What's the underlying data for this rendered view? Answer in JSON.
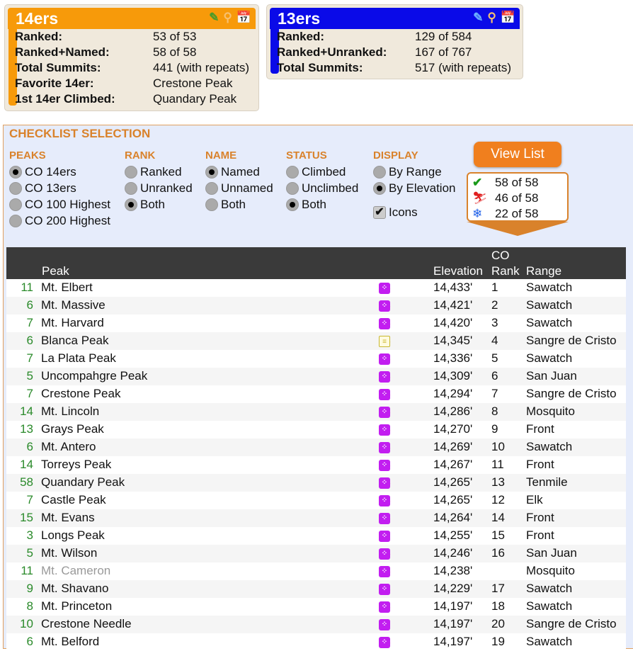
{
  "cards": [
    {
      "title": "14ers",
      "color": "#f79a0a",
      "rows": [
        [
          "Ranked:",
          "53 of 53"
        ],
        [
          "Ranked+Named:",
          "58 of 58"
        ],
        [
          "Total Summits:",
          "441 (with repeats)"
        ],
        [
          "Favorite 14er:",
          "Crestone Peak"
        ],
        [
          "1st 14er Climbed:",
          "Quandary Peak"
        ]
      ]
    },
    {
      "title": "13ers",
      "color": "#0a0ae8",
      "rows": [
        [
          "Ranked:",
          "129 of 584"
        ],
        [
          "Ranked+Unranked:",
          "167 of 767"
        ],
        [
          "Total Summits:",
          "517 (with repeats)"
        ]
      ]
    }
  ],
  "selection": {
    "title": "CHECKLIST SELECTION",
    "groups": [
      {
        "title": "PEAKS",
        "options": [
          "CO 14ers",
          "CO 13ers",
          "CO 100 Highest",
          "CO 200 Highest"
        ],
        "selected": 0
      },
      {
        "title": "RANK",
        "options": [
          "Ranked",
          "Unranked",
          "Both"
        ],
        "selected": 2
      },
      {
        "title": "NAME",
        "options": [
          "Named",
          "Unnamed",
          "Both"
        ],
        "selected": 0
      },
      {
        "title": "STATUS",
        "options": [
          "Climbed",
          "Unclimbed",
          "Both"
        ],
        "selected": 2
      },
      {
        "title": "DISPLAY",
        "options": [
          "By Range",
          "By Elevation"
        ],
        "selected": 1
      }
    ],
    "icons_label": "Icons",
    "icons_checked": true,
    "view_list": "View List",
    "stats": [
      {
        "icon": "check",
        "text": "58 of 58"
      },
      {
        "icon": "ski",
        "text": "46 of 58"
      },
      {
        "icon": "snow",
        "text": "22 of 58"
      }
    ]
  },
  "table": {
    "headers": {
      "peak": "Peak",
      "elevation": "Elevation",
      "rank_top": "CO",
      "rank": "Rank",
      "range": "Range"
    },
    "rows": [
      {
        "n": "11",
        "peak": "Mt. Elbert",
        "icons": "ski,snow,hike,dice",
        "elev": "14,433'",
        "rank": "1",
        "range": "Sawatch"
      },
      {
        "n": "6",
        "peak": "Mt. Massive",
        "icons": "ski,snow,hike,dice",
        "elev": "14,421'",
        "rank": "2",
        "range": "Sawatch"
      },
      {
        "n": "7",
        "peak": "Mt. Harvard",
        "icons": "ski,snow,hike,dice",
        "elev": "14,420'",
        "rank": "3",
        "range": "Sawatch"
      },
      {
        "n": "6",
        "peak": "Blanca Peak",
        "icons": "ski,hike,dice,doc",
        "elev": "14,345'",
        "rank": "4",
        "range": "Sangre de Cristo"
      },
      {
        "n": "7",
        "peak": "La Plata Peak",
        "icons": "ski,snow,hike,dice",
        "elev": "14,336'",
        "rank": "5",
        "range": "Sawatch"
      },
      {
        "n": "5",
        "peak": "Uncompahgre Peak",
        "icons": "ski,hike,dice",
        "elev": "14,309'",
        "rank": "6",
        "range": "San Juan"
      },
      {
        "n": "7",
        "peak": "Crestone Peak",
        "icons": "ski,hike,dice",
        "elev": "14,294'",
        "rank": "7",
        "range": "Sangre de Cristo"
      },
      {
        "n": "14",
        "peak": "Mt. Lincoln",
        "icons": "ski,snow,hike,dice",
        "elev": "14,286'",
        "rank": "8",
        "range": "Mosquito"
      },
      {
        "n": "13",
        "peak": "Grays Peak",
        "icons": "ski,snow,hike,dice",
        "elev": "14,270'",
        "rank": "9",
        "range": "Front"
      },
      {
        "n": "6",
        "peak": "Mt. Antero",
        "icons": "ski,snow,hike,dice",
        "elev": "14,269'",
        "rank": "10",
        "range": "Sawatch"
      },
      {
        "n": "14",
        "peak": "Torreys Peak",
        "icons": "ski,snow,hike,dice",
        "elev": "14,267'",
        "rank": "11",
        "range": "Front"
      },
      {
        "n": "58",
        "peak": "Quandary Peak",
        "icons": "ski,snow,hike,dice",
        "elev": "14,265'",
        "rank": "13",
        "range": "Tenmile"
      },
      {
        "n": "7",
        "peak": "Castle Peak",
        "icons": "ski,hike,dice",
        "elev": "14,265'",
        "rank": "12",
        "range": "Elk"
      },
      {
        "n": "15",
        "peak": "Mt. Evans",
        "icons": "ski,snow,hike,dice",
        "elev": "14,264'",
        "rank": "14",
        "range": "Front"
      },
      {
        "n": "3",
        "peak": "Longs Peak",
        "icons": "hike,dice",
        "elev": "14,255'",
        "rank": "15",
        "range": "Front"
      },
      {
        "n": "5",
        "peak": "Mt. Wilson",
        "icons": "ski,snow,hike,dice",
        "elev": "14,246'",
        "rank": "16",
        "range": "San Juan"
      },
      {
        "n": "11",
        "peak": "Mt. Cameron",
        "icons": "ski,snow,hike,dice",
        "elev": "14,238'",
        "rank": "",
        "range": "Mosquito",
        "unranked": true
      },
      {
        "n": "9",
        "peak": "Mt. Shavano",
        "icons": "ski,snow,hike,dice",
        "elev": "14,229'",
        "rank": "17",
        "range": "Sawatch"
      },
      {
        "n": "8",
        "peak": "Mt. Princeton",
        "icons": "ski,snow,hike,dice",
        "elev": "14,197'",
        "rank": "18",
        "range": "Sawatch"
      },
      {
        "n": "10",
        "peak": "Crestone Needle",
        "icons": "hike,dice",
        "elev": "14,197'",
        "rank": "20",
        "range": "Sangre de Cristo"
      },
      {
        "n": "6",
        "peak": "Mt. Belford",
        "icons": "ski,hike,dice",
        "elev": "14,197'",
        "rank": "19",
        "range": "Sawatch"
      }
    ]
  }
}
